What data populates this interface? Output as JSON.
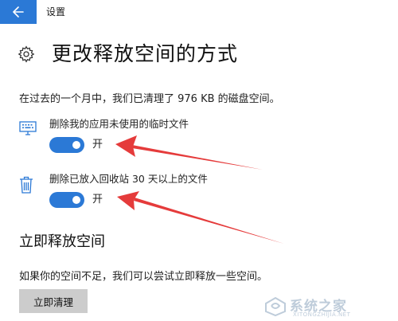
{
  "window": {
    "title": "设置"
  },
  "header": {
    "title": "更改释放空间的方式"
  },
  "summary": {
    "text": "在过去的一个月中，我们已清理了 976 KB 的磁盘空间。"
  },
  "options": [
    {
      "label": "删除我的应用未使用的临时文件",
      "state_label": "开",
      "on": true,
      "icon": "monitor-icon"
    },
    {
      "label": "删除已放入回收站 30 天以上的文件",
      "state_label": "开",
      "on": true,
      "icon": "recycle-bin-icon"
    }
  ],
  "free_now": {
    "heading": "立即释放空间",
    "description": "如果你的空间不足，我们可以尝试立即释放一些空间。",
    "button_label": "立即清理"
  },
  "watermark": {
    "text": "系统之家",
    "url": "XITONGZHIJIA.NET"
  },
  "colors": {
    "accent": "#2b79d6",
    "annotation_arrow": "#e53b3b",
    "button_bg": "#cccccc"
  }
}
